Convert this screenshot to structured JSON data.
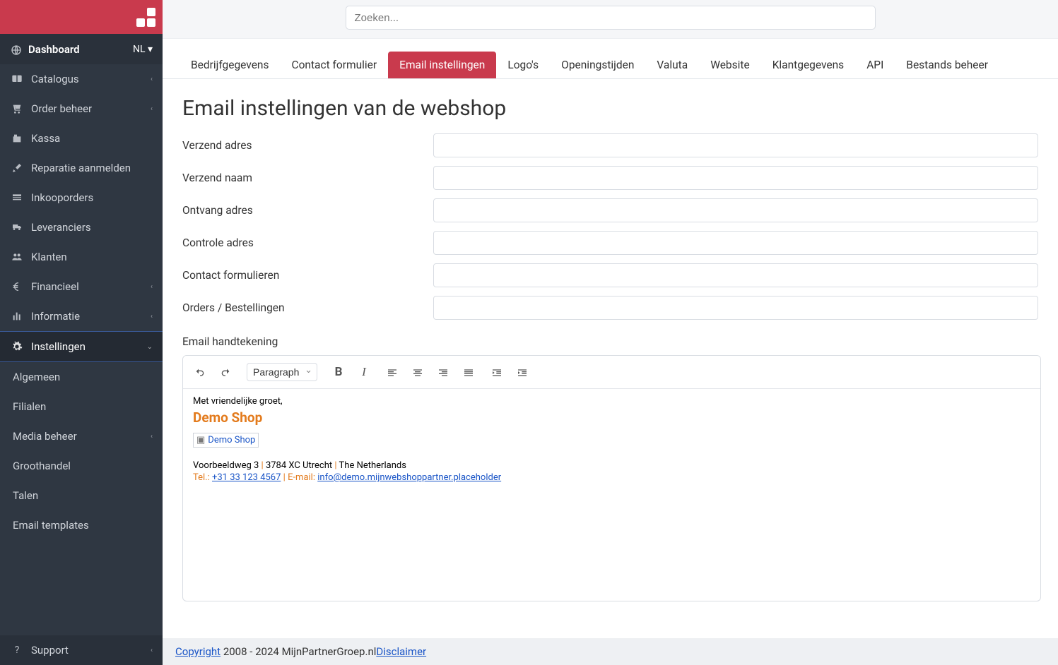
{
  "search": {
    "placeholder": "Zoeken..."
  },
  "header": {
    "dashboard": "Dashboard",
    "lang": "NL"
  },
  "sidebar": {
    "items": [
      {
        "label": "Catalogus",
        "icon": "book",
        "expandable": true
      },
      {
        "label": "Order beheer",
        "icon": "cart",
        "expandable": true
      },
      {
        "label": "Kassa",
        "icon": "register",
        "expandable": false
      },
      {
        "label": "Reparatie aanmelden",
        "icon": "tools",
        "expandable": false
      },
      {
        "label": "Inkooporders",
        "icon": "cardlist",
        "expandable": false
      },
      {
        "label": "Leveranciers",
        "icon": "truck",
        "expandable": false
      },
      {
        "label": "Klanten",
        "icon": "users",
        "expandable": false
      },
      {
        "label": "Financieel",
        "icon": "euro",
        "expandable": true
      },
      {
        "label": "Informatie",
        "icon": "bars",
        "expandable": true
      },
      {
        "label": "Instellingen",
        "icon": "gears",
        "expandable": true,
        "active": true
      }
    ],
    "subitems": [
      {
        "label": "Algemeen"
      },
      {
        "label": "Filialen"
      },
      {
        "label": "Media beheer",
        "expandable": true
      },
      {
        "label": "Groothandel"
      },
      {
        "label": "Talen"
      },
      {
        "label": "Email templates"
      }
    ],
    "support": "Support"
  },
  "tabs": [
    "Bedrijfgegevens",
    "Contact formulier",
    "Email instellingen",
    "Logo's",
    "Openingstijden",
    "Valuta",
    "Website",
    "Klantgegevens",
    "API",
    "Bestands beheer"
  ],
  "active_tab_index": 2,
  "page_title": "Email instellingen van de webshop",
  "fields": [
    {
      "label": "Verzend adres",
      "value": ""
    },
    {
      "label": "Verzend naam",
      "value": ""
    },
    {
      "label": "Ontvang adres",
      "value": ""
    },
    {
      "label": "Controle adres",
      "value": ""
    },
    {
      "label": "Contact formulieren",
      "value": ""
    },
    {
      "label": "Orders / Bestellingen",
      "value": ""
    }
  ],
  "signature_label": "Email handtekening",
  "editor": {
    "paragraph_label": "Paragraph",
    "greeting": "Met vriendelijke groet,",
    "shop_name": "Demo Shop",
    "broken_img_alt": "Demo Shop",
    "address": {
      "street": "Voorbeeldweg 3",
      "postal_city": "3784 XC  Utrecht",
      "country": "The Netherlands"
    },
    "contact": {
      "tel_label": "Tel.:",
      "tel": "+31 33 123 4567",
      "email_label": "E-mail:",
      "email": "info@demo.mijnwebshoppartner.placeholder"
    }
  },
  "footer": {
    "copyright_link": "Copyright",
    "middle": " 2008 - 2024 MijnPartnerGroep.nl",
    "disclaimer_link": "Disclaimer"
  }
}
